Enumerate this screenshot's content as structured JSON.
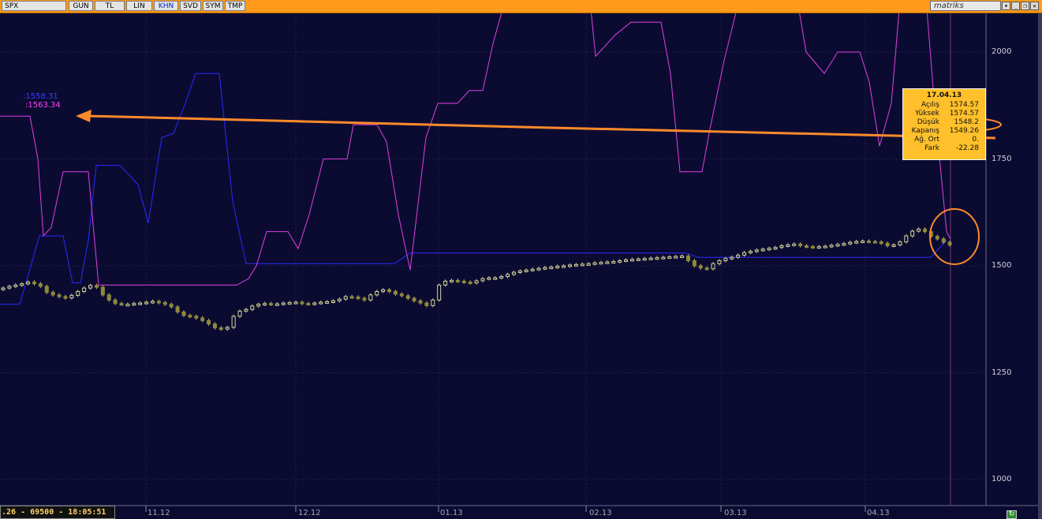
{
  "toolbar": {
    "symbol": "SPX",
    "buttons": [
      {
        "label": "GUN",
        "active": false
      },
      {
        "label": "TL",
        "active": false
      },
      {
        "label": "LIN",
        "active": false
      },
      {
        "label": "KHN",
        "active": true
      },
      {
        "label": "SVD",
        "active": false
      },
      {
        "label": "SYM",
        "active": false
      },
      {
        "label": "TMP",
        "active": false
      }
    ],
    "brand": "matriks",
    "window_controls": [
      "▾",
      "_",
      "❐",
      "✕"
    ]
  },
  "info_box": {
    "date": "17.04.13",
    "rows": [
      {
        "label": "Açılış",
        "value": "1574.57"
      },
      {
        "label": "Yüksek",
        "value": "1574.57"
      },
      {
        "label": "Düşük",
        "value": "1548.2"
      },
      {
        "label": "Kapanış",
        "value": "1549.26"
      },
      {
        "label": "Ağ. Ort",
        "value": "0."
      },
      {
        "label": "Fark",
        "value": "-22.28"
      }
    ]
  },
  "indicator_values": {
    "blue": ":1558.31",
    "magenta": ":1563.34"
  },
  "status": ".26 - 69500 - 18:05:51",
  "chart_data": {
    "type": "candlestick",
    "x_labels": [
      "11.12",
      "12.12",
      "01.13",
      "02.13",
      "03.13",
      "04.13"
    ],
    "y_ticks": [
      1000,
      1250,
      1500,
      1750,
      2000
    ],
    "ylim": [
      965,
      2085
    ],
    "close_series": [
      1448,
      1452,
      1455,
      1458,
      1462,
      1458,
      1452,
      1438,
      1432,
      1428,
      1425,
      1431,
      1440,
      1448,
      1454,
      1450,
      1432,
      1420,
      1412,
      1410,
      1410,
      1412,
      1413,
      1415,
      1417,
      1414,
      1410,
      1404,
      1392,
      1384,
      1382,
      1378,
      1372,
      1364,
      1355,
      1352,
      1356,
      1382,
      1394,
      1398,
      1406,
      1410,
      1412,
      1410,
      1411,
      1413,
      1414,
      1415,
      1412,
      1411,
      1413,
      1415,
      1416,
      1418,
      1422,
      1428,
      1427,
      1424,
      1420,
      1432,
      1440,
      1444,
      1440,
      1434,
      1430,
      1424,
      1418,
      1413,
      1407,
      1420,
      1455,
      1464,
      1466,
      1464,
      1462,
      1460,
      1465,
      1470,
      1472,
      1472,
      1475,
      1480,
      1485,
      1488,
      1490,
      1492,
      1494,
      1496,
      1497,
      1499,
      1500,
      1502,
      1503,
      1504,
      1505,
      1507,
      1508,
      1509,
      1510,
      1512,
      1514,
      1515,
      1516,
      1517,
      1518,
      1519,
      1520,
      1521,
      1522,
      1523,
      1512,
      1500,
      1495,
      1493,
      1505,
      1512,
      1517,
      1520,
      1525,
      1531,
      1534,
      1537,
      1539,
      1541,
      1543,
      1547,
      1549,
      1551,
      1547,
      1545,
      1544,
      1545,
      1546,
      1548,
      1550,
      1552,
      1555,
      1557,
      1558,
      1557,
      1556,
      1553,
      1547,
      1549,
      1556,
      1570,
      1581,
      1586,
      1580,
      1569,
      1563,
      1555,
      1549
    ],
    "blue_line": [
      [
        0,
        1410
      ],
      [
        25,
        1410
      ],
      [
        50,
        1570
      ],
      [
        80,
        1570
      ],
      [
        92,
        1460
      ],
      [
        102,
        1460
      ],
      [
        112,
        1560
      ],
      [
        122,
        1735
      ],
      [
        152,
        1735
      ],
      [
        175,
        1690
      ],
      [
        188,
        1600
      ],
      [
        205,
        1800
      ],
      [
        220,
        1810
      ],
      [
        235,
        1880
      ],
      [
        248,
        1950
      ],
      [
        278,
        1950
      ],
      [
        295,
        1650
      ],
      [
        312,
        1505
      ],
      [
        500,
        1505
      ],
      [
        520,
        1530
      ],
      [
        870,
        1530
      ],
      [
        885,
        1520
      ],
      [
        1180,
        1520
      ],
      [
        1200,
        1560
      ]
    ],
    "magenta_line": [
      [
        0,
        1850
      ],
      [
        38,
        1850
      ],
      [
        48,
        1750
      ],
      [
        55,
        1570
      ],
      [
        65,
        1590
      ],
      [
        80,
        1720
      ],
      [
        112,
        1720
      ],
      [
        125,
        1455
      ],
      [
        300,
        1455
      ],
      [
        315,
        1470
      ],
      [
        325,
        1500
      ],
      [
        338,
        1580
      ],
      [
        365,
        1580
      ],
      [
        378,
        1540
      ],
      [
        392,
        1620
      ],
      [
        410,
        1750
      ],
      [
        440,
        1750
      ],
      [
        448,
        1830
      ],
      [
        478,
        1830
      ],
      [
        490,
        1790
      ],
      [
        505,
        1620
      ],
      [
        520,
        1490
      ],
      [
        540,
        1800
      ],
      [
        555,
        1880
      ],
      [
        580,
        1880
      ],
      [
        595,
        1910
      ],
      [
        612,
        1910
      ],
      [
        625,
        2020
      ],
      [
        640,
        2120
      ],
      [
        748,
        2120
      ],
      [
        755,
        1990
      ],
      [
        780,
        2040
      ],
      [
        800,
        2070
      ],
      [
        838,
        2070
      ],
      [
        850,
        1950
      ],
      [
        862,
        1720
      ],
      [
        890,
        1720
      ],
      [
        900,
        1820
      ],
      [
        918,
        1980
      ],
      [
        938,
        2130
      ],
      [
        1010,
        2130
      ],
      [
        1022,
        2000
      ],
      [
        1045,
        1950
      ],
      [
        1062,
        2000
      ],
      [
        1090,
        2000
      ],
      [
        1102,
        1930
      ],
      [
        1115,
        1780
      ],
      [
        1130,
        1880
      ],
      [
        1140,
        2100
      ],
      [
        1175,
        2100
      ],
      [
        1185,
        1870
      ],
      [
        1200,
        1580
      ],
      [
        1205,
        1563
      ]
    ],
    "vertical_marker_x": 1205,
    "annotation_arrow": {
      "to_label": "1563.34",
      "from_value": "1548.2"
    }
  }
}
